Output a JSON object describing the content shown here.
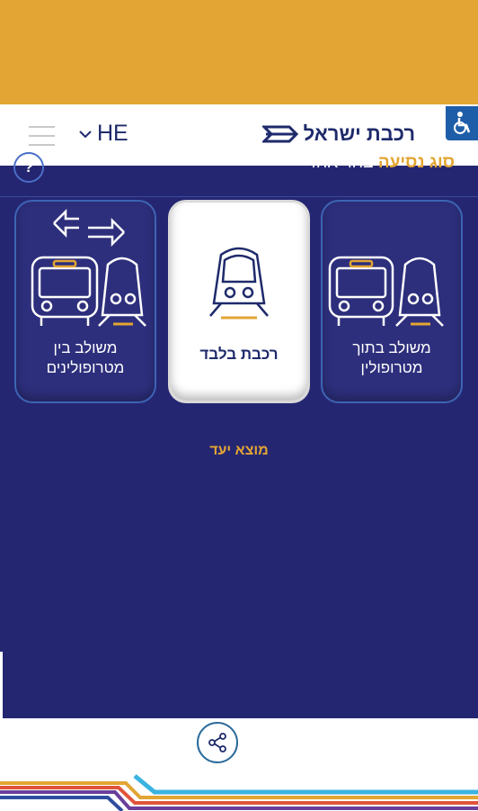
{
  "colors": {
    "accent": "#E3A533",
    "navy": "#252672",
    "brand": "#1E2A6B"
  },
  "header": {
    "language": "HE",
    "brand_name": "רכבת ישראל"
  },
  "trip": {
    "subtitle_highlight": "סוג נסיעה",
    "subtitle_rest": "בחר אחד",
    "help": "?"
  },
  "cards": [
    {
      "label": "משולב בין מטרופולינים",
      "icon": "bus-train-transfer-icon",
      "selected": false
    },
    {
      "label": "רכבת בלבד",
      "icon": "train-icon",
      "selected": true
    },
    {
      "label": "משולב בתוך מטרופולין",
      "icon": "bus-train-icon",
      "selected": false
    }
  ],
  "destination_label": "מוצא יעד",
  "footer": {
    "share_icon": "share-icon"
  }
}
